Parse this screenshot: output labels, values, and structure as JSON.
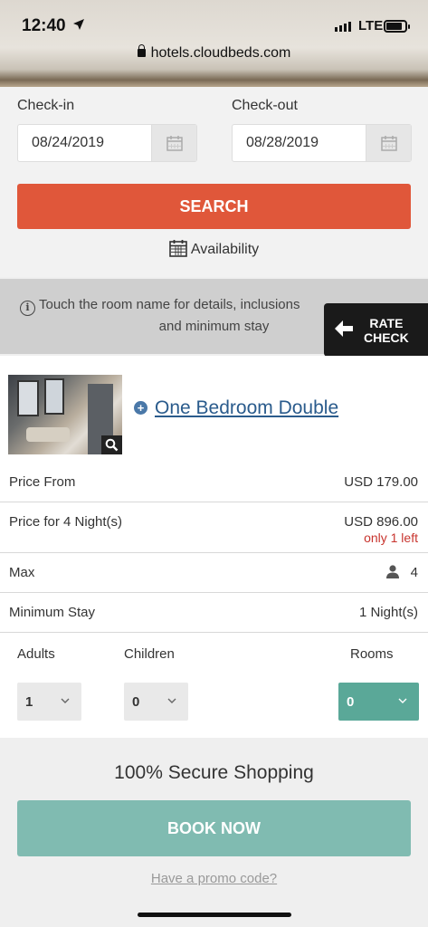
{
  "status_bar": {
    "time": "12:40",
    "network": "LTE"
  },
  "browser": {
    "url": "hotels.cloudbeds.com"
  },
  "search": {
    "checkin_label": "Check-in",
    "checkin_value": "08/24/2019",
    "checkout_label": "Check-out",
    "checkout_value": "08/28/2019",
    "search_label": "SEARCH",
    "availability_label": "Availability"
  },
  "info": {
    "line1": "Touch the room name for details, inclusions",
    "line2": "and minimum stay",
    "rate_check_line1": "RATE",
    "rate_check_line2": "CHECK"
  },
  "room": {
    "title": "One Bedroom Double",
    "price_from_label": "Price From",
    "price_from_value": "USD 179.00",
    "price_nights_label": "Price for 4 Night(s)",
    "price_nights_value": "USD 896.00",
    "availability_note": "only 1 left",
    "max_label": "Max",
    "max_value": "4",
    "min_stay_label": "Minimum Stay",
    "min_stay_value": "1 Night(s)",
    "adults_label": "Adults",
    "adults_value": "1",
    "children_label": "Children",
    "children_value": "0",
    "rooms_label": "Rooms",
    "rooms_value": "0"
  },
  "checkout": {
    "secure_label": "100% Secure Shopping",
    "book_label": "BOOK NOW",
    "promo_label": "Have a promo code?"
  },
  "colors": {
    "search": "#e0573a",
    "book": "#80bbb1",
    "rooms_select": "#5aa898",
    "link": "#2a5b8c",
    "warning": "#c8342e"
  }
}
